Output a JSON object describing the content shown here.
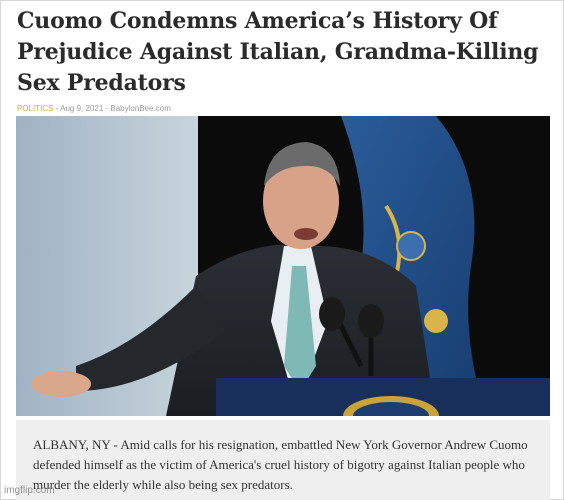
{
  "article": {
    "headline": "Cuomo Condemns America’s History Of Prejudice Against Italian, Grandma-Killing Sex Predators",
    "category": "POLITICS",
    "separator1": " - ",
    "date": "Aug 9, 2021",
    "separator2": " - ",
    "source": "BabylonBee.com",
    "body": "ALBANY, NY - Amid calls for his resignation, embattled New York Governor Andrew Cuomo defended himself as the victim of America's cruel history of bigotry against Italian people who murder the elderly while also being sex predators."
  },
  "watermark": "imgflip.com",
  "colors": {
    "category": "#e8a13a",
    "headline": "#2b2b2b",
    "caption_bg": "#efefef",
    "flag_blue": "#1f4e8c"
  }
}
